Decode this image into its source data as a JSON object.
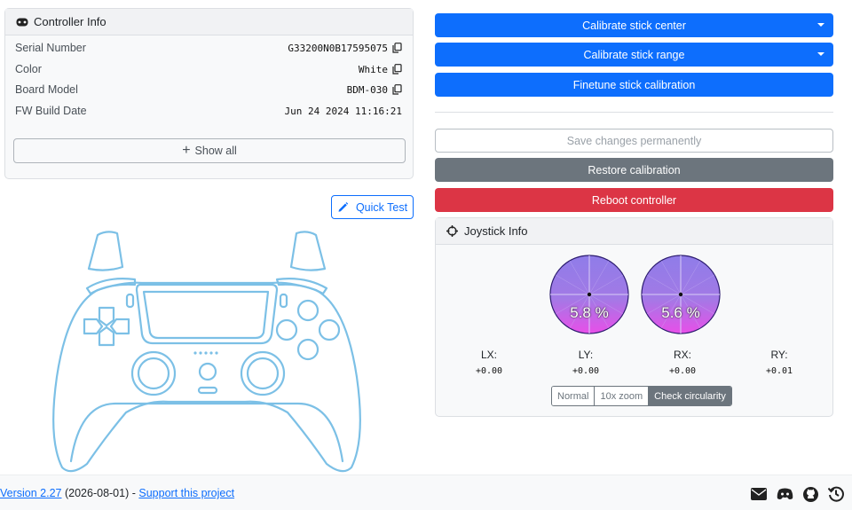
{
  "controller_info": {
    "title": "Controller Info",
    "rows": [
      {
        "label": "Serial Number",
        "value": "G33200N0B17595075"
      },
      {
        "label": "Color",
        "value": "White"
      },
      {
        "label": "Board Model",
        "value": "BDM-030"
      },
      {
        "label": "FW Build Date",
        "value": "Jun 24 2024 11:16:21"
      }
    ],
    "show_all_label": "Show all"
  },
  "quick_test_label": "Quick Test",
  "actions": {
    "calibrate_center": "Calibrate stick center",
    "calibrate_range": "Calibrate stick range",
    "finetune": "Finetune stick calibration",
    "save": "Save changes permanently",
    "restore": "Restore calibration",
    "reboot": "Reboot controller"
  },
  "joystick": {
    "title": "Joystick Info",
    "left_pct": "5.8 %",
    "right_pct": "5.6 %",
    "axes": [
      {
        "label": "LX:",
        "value": "+0.00"
      },
      {
        "label": "LY:",
        "value": "+0.00"
      },
      {
        "label": "RX:",
        "value": "+0.00"
      },
      {
        "label": "RY:",
        "value": "+0.01"
      }
    ],
    "modes": [
      "Normal",
      "10x zoom",
      "Check circularity"
    ],
    "active_mode": "Check circularity"
  },
  "footer": {
    "version_link": "Version 2.27",
    "date": "(2026-08-01)",
    "separator": "-",
    "support_link": "Support this project",
    "icons": [
      "envelope-icon",
      "discord-icon",
      "github-icon",
      "history-icon"
    ]
  },
  "colors": {
    "primary": "#0d6efd",
    "secondary": "#6c757d",
    "danger": "#dc3545",
    "controller_outline": "#7cc0e6"
  }
}
